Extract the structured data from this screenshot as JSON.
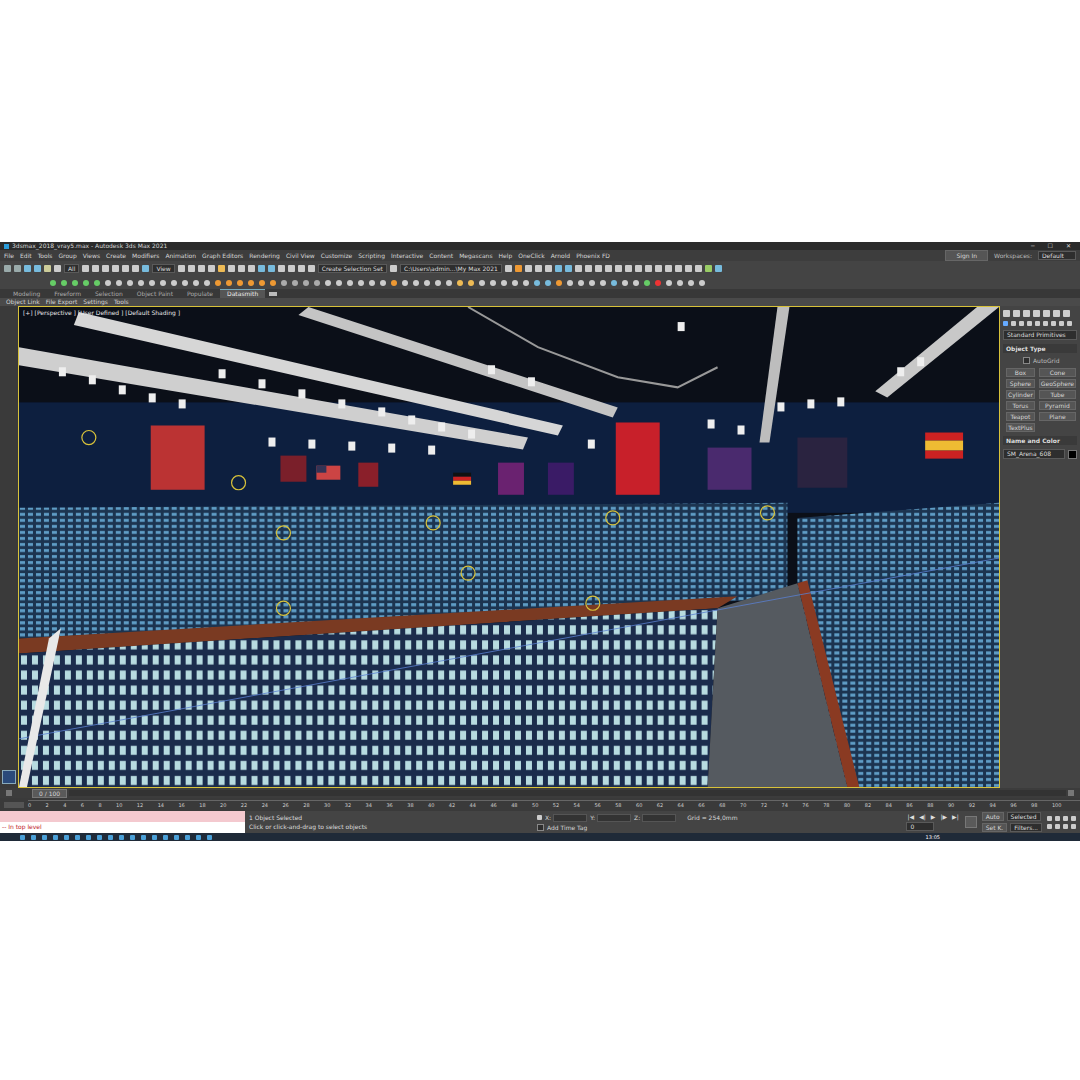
{
  "window": {
    "title": "3dsmax_2018_vray5.max - Autodesk 3ds Max 2021",
    "controls": [
      "─",
      "☐",
      "✕"
    ]
  },
  "menu": [
    "File",
    "Edit",
    "Tools",
    "Group",
    "Views",
    "Create",
    "Modifiers",
    "Animation",
    "Graph Editors",
    "Rendering",
    "Civil View",
    "Customize",
    "Scripting",
    "Interactive",
    "Content",
    "Megascans",
    "Help",
    "OneClick",
    "Arnold",
    "Phoenix FD"
  ],
  "account": {
    "sign_in": "Sign In",
    "workspaces_label": "Workspaces:",
    "workspace": "Default"
  },
  "toolbar": {
    "filter": "All",
    "reference": "View",
    "selection_set": "Create Selection Set",
    "project_path": "C:\\Users\\admin...\\My Max 2021"
  },
  "ribbon": {
    "tabs": [
      {
        "label": "Modeling",
        "selected": false
      },
      {
        "label": "Freeform",
        "selected": false
      },
      {
        "label": "Selection",
        "selected": false
      },
      {
        "label": "Object Paint",
        "selected": false
      },
      {
        "label": "Populate",
        "selected": false
      },
      {
        "label": "Datasmith",
        "selected": true
      }
    ],
    "panel": [
      "Object Link",
      "File Export",
      "Settings",
      "Tools"
    ]
  },
  "viewport": {
    "label": "[+] [Perspective ] [User Defined ] [Default Shading ]"
  },
  "command_panel": {
    "category": "Standard Primitives",
    "object_type_title": "Object Type",
    "autogrid": {
      "label": "AutoGrid",
      "checked": false
    },
    "buttons": [
      "Box",
      "Cone",
      "Sphere",
      "GeoSphere",
      "Cylinder",
      "Tube",
      "Torus",
      "Pyramid",
      "Teapot",
      "Plane",
      "TextPlus"
    ],
    "name_color_title": "Name and Color",
    "object_name": "SM_Arena_608"
  },
  "timeline": {
    "frame": "0 / 100",
    "ticks": [
      "0",
      "2",
      "4",
      "6",
      "8",
      "10",
      "12",
      "14",
      "16",
      "18",
      "20",
      "22",
      "24",
      "26",
      "28",
      "30",
      "32",
      "34",
      "36",
      "38",
      "40",
      "42",
      "44",
      "46",
      "48",
      "50",
      "52",
      "54",
      "56",
      "58",
      "60",
      "62",
      "64",
      "66",
      "68",
      "70",
      "72",
      "74",
      "76",
      "78",
      "80",
      "82",
      "84",
      "86",
      "88",
      "90",
      "92",
      "94",
      "96",
      "98",
      "100"
    ]
  },
  "listener": {
    "output": "-- In top level"
  },
  "status": {
    "selection": "1 Object Selected",
    "prompt": "Click or click-and-drag to select objects",
    "coords": [
      "X:",
      "Y:",
      "Z:"
    ],
    "grid": "Grid = 254,0mm",
    "time_tag": "Add Time Tag"
  },
  "animation": {
    "playback": [
      "|◀",
      "◀|",
      "▶",
      "|▶",
      "▶|"
    ],
    "frame": "0",
    "auto": "Auto",
    "key_filter": "Selected",
    "set_key": "Set K.",
    "filters": "Filters..."
  },
  "taskbar": {
    "clock": "13:05"
  }
}
